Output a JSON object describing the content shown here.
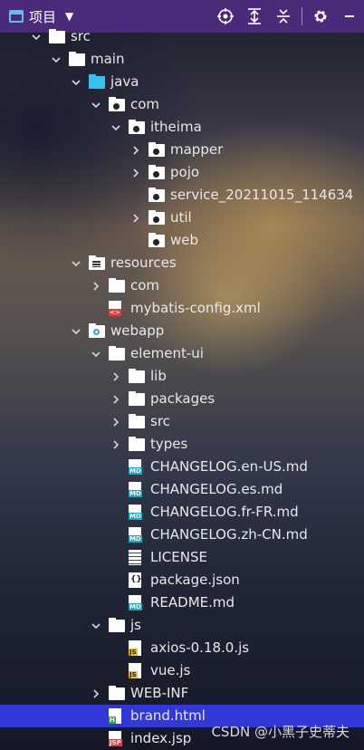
{
  "toolbar": {
    "title": "项目",
    "buttons": [
      {
        "name": "locate-icon"
      },
      {
        "name": "expand-all-icon"
      },
      {
        "name": "collapse-all-icon"
      },
      {
        "name": "settings-icon"
      },
      {
        "name": "hide-icon"
      }
    ]
  },
  "tree": [
    {
      "label": "src",
      "icon": "folder",
      "chev": "down",
      "depth": 0
    },
    {
      "label": "main",
      "icon": "folder",
      "chev": "down",
      "depth": 1
    },
    {
      "label": "java",
      "icon": "folder-blue",
      "chev": "down",
      "depth": 2
    },
    {
      "label": "com",
      "icon": "folder-dot",
      "chev": "down",
      "depth": 3
    },
    {
      "label": "itheima",
      "icon": "folder-dot",
      "chev": "down",
      "depth": 4
    },
    {
      "label": "mapper",
      "icon": "folder-dot",
      "chev": "right",
      "depth": 5
    },
    {
      "label": "pojo",
      "icon": "folder-dot",
      "chev": "right",
      "depth": 5
    },
    {
      "label": "service_20211015_114634",
      "icon": "folder-dot",
      "chev": "",
      "depth": 5
    },
    {
      "label": "util",
      "icon": "folder-dot",
      "chev": "right",
      "depth": 5
    },
    {
      "label": "web",
      "icon": "folder-dot",
      "chev": "",
      "depth": 5
    },
    {
      "label": "resources",
      "icon": "folder-res",
      "chev": "down",
      "depth": 2
    },
    {
      "label": "com",
      "icon": "folder",
      "chev": "right",
      "depth": 3
    },
    {
      "label": "mybatis-config.xml",
      "icon": "file-xml",
      "chev": "",
      "depth": 3
    },
    {
      "label": "webapp",
      "icon": "folder-web",
      "chev": "down",
      "depth": 2
    },
    {
      "label": "element-ui",
      "icon": "folder",
      "chev": "down",
      "depth": 3
    },
    {
      "label": "lib",
      "icon": "folder",
      "chev": "right",
      "depth": 4
    },
    {
      "label": "packages",
      "icon": "folder",
      "chev": "right",
      "depth": 4
    },
    {
      "label": "src",
      "icon": "folder",
      "chev": "right",
      "depth": 4
    },
    {
      "label": "types",
      "icon": "folder",
      "chev": "right",
      "depth": 4
    },
    {
      "label": "CHANGELOG.en-US.md",
      "icon": "file-md",
      "chev": "",
      "depth": 4
    },
    {
      "label": "CHANGELOG.es.md",
      "icon": "file-md",
      "chev": "",
      "depth": 4
    },
    {
      "label": "CHANGELOG.fr-FR.md",
      "icon": "file-md",
      "chev": "",
      "depth": 4
    },
    {
      "label": "CHANGELOG.zh-CN.md",
      "icon": "file-md",
      "chev": "",
      "depth": 4
    },
    {
      "label": "LICENSE",
      "icon": "file-text",
      "chev": "",
      "depth": 4
    },
    {
      "label": "package.json",
      "icon": "file-json",
      "chev": "",
      "depth": 4
    },
    {
      "label": "README.md",
      "icon": "file-md",
      "chev": "",
      "depth": 4
    },
    {
      "label": "js",
      "icon": "folder",
      "chev": "down",
      "depth": 3
    },
    {
      "label": "axios-0.18.0.js",
      "icon": "file-js-min",
      "chev": "",
      "depth": 4
    },
    {
      "label": "vue.js",
      "icon": "file-js",
      "chev": "",
      "depth": 4
    },
    {
      "label": "WEB-INF",
      "icon": "folder",
      "chev": "right",
      "depth": 3
    },
    {
      "label": "brand.html",
      "icon": "file-html",
      "chev": "",
      "depth": 3,
      "selected": true
    },
    {
      "label": "index.jsp",
      "icon": "file-jsp",
      "chev": "",
      "depth": 3
    }
  ],
  "badges": {
    "md": "MD",
    "xml": "<>",
    "js": "JS",
    "html": "H",
    "jsp": "JSP",
    "min": "101"
  },
  "watermark": "CSDN @小黑子史蒂夫",
  "colors": {
    "toolbar_bg": "#4a2a7a",
    "selected_bg": "#3238d8",
    "java_folder": "#38c0f0"
  }
}
